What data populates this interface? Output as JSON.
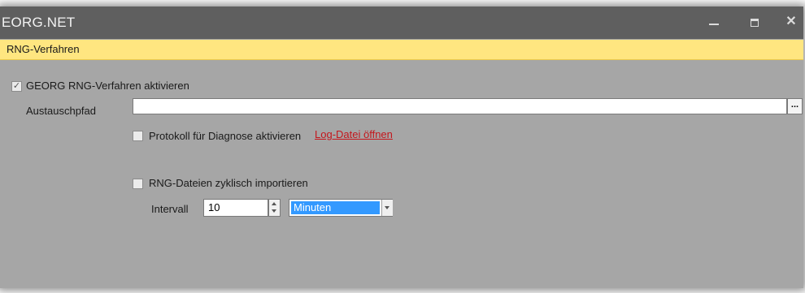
{
  "window": {
    "title": "EORG.NET",
    "minimize_label": "minimize",
    "maximize_label": "maximize",
    "close_glyph": "✕"
  },
  "section": {
    "title": "RNG-Verfahren",
    "color": "#ffe680"
  },
  "form": {
    "enable_rng": {
      "label": "GEORG RNG-Verfahren aktivieren",
      "checked": true,
      "glyph": "✓"
    },
    "exchange_path": {
      "label": "Austauschpfad",
      "value": "",
      "browse_label": "..."
    },
    "diagnostics_log": {
      "label": "Protokoll für Diagnose aktivieren",
      "checked": false
    },
    "open_log_link": "Log-Datei öffnen",
    "cyclic_import": {
      "label": "RNG-Dateien zyklisch importieren",
      "checked": false
    },
    "interval": {
      "label": "Intervall",
      "value": "10",
      "unit": "Minuten"
    }
  },
  "colors": {
    "titlebar": "#5f5f5f",
    "body": "#a6a6a6",
    "link": "#c4161c",
    "selection": "#3399ff"
  },
  "icons": [
    "window-minimize-icon",
    "window-maximize-icon",
    "window-close-icon",
    "checkmark-icon",
    "spin-up-icon",
    "spin-down-icon",
    "dropdown-arrow-icon"
  ]
}
